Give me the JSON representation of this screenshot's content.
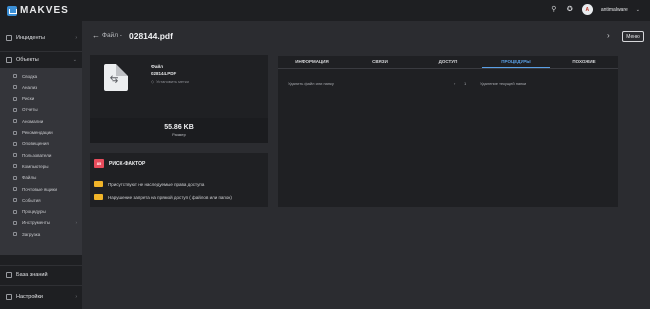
{
  "app": {
    "logo": "MAKVES"
  },
  "topbar": {
    "search_icon": "search-icon",
    "alert_icon": "badge-icon",
    "user_initials": "A",
    "username": "antimalware"
  },
  "sidebar": {
    "incidents": "Инциденты",
    "objects": "Объекты",
    "objects_items": [
      {
        "label": "Сводка",
        "icon": "summary-icon"
      },
      {
        "label": "Анализ",
        "icon": "analysis-icon"
      },
      {
        "label": "Риски",
        "icon": "risk-icon"
      },
      {
        "label": "Отчеты",
        "icon": "report-icon"
      },
      {
        "label": "Аномалии",
        "icon": "anomaly-icon"
      },
      {
        "label": "Рекомендации",
        "icon": "recommend-icon"
      },
      {
        "label": "Оповещения",
        "icon": "bell-icon"
      },
      {
        "label": "Пользователи",
        "icon": "users-icon"
      },
      {
        "label": "Компьютеры",
        "icon": "computer-icon"
      },
      {
        "label": "Файлы",
        "icon": "file-icon"
      },
      {
        "label": "Почтовые ящики",
        "icon": "mail-icon"
      },
      {
        "label": "События",
        "icon": "events-icon"
      },
      {
        "label": "Процедуры",
        "icon": "procedure-icon"
      },
      {
        "label": "Инструменты",
        "icon": "tools-icon"
      },
      {
        "label": "Загрузка",
        "icon": "upload-icon"
      }
    ],
    "knowledge_base": "База знаний",
    "settings": "Настройки"
  },
  "header": {
    "crumb": "Файл -",
    "title": "028144.pdf",
    "menu_label": "Меню"
  },
  "file": {
    "type_label": "Файл",
    "name": "028144.PDF",
    "set_label_action": "Установить метки",
    "size": "55.86 KB",
    "size_label": "Размер"
  },
  "risk": {
    "badge": "85",
    "title": "РИСК-ФАКТОР",
    "items": [
      "Присутствуют не наследуемые права доступа",
      "Нарушение запрета на прямой доступ ( файлов или папок)"
    ],
    "badge_color": "#e74c5c",
    "item_color": "#f0b429"
  },
  "tabs": [
    {
      "label": "ИНФОРМАЦИЯ"
    },
    {
      "label": "СВЯЗИ"
    },
    {
      "label": "ДОСТУП"
    },
    {
      "label": "ПРОЦЕДУРЫ",
      "active": true
    },
    {
      "label": "ПОХОЖИЕ"
    }
  ],
  "procedures": [
    {
      "name": "Удалить файл или папку",
      "arrow": "›",
      "count": "1",
      "description": "Удаление текущей папки"
    }
  ],
  "colors": {
    "accent": "#5aa0e6",
    "sidebar_bg": "#1e1f22",
    "main_bg": "#2b2c30"
  }
}
